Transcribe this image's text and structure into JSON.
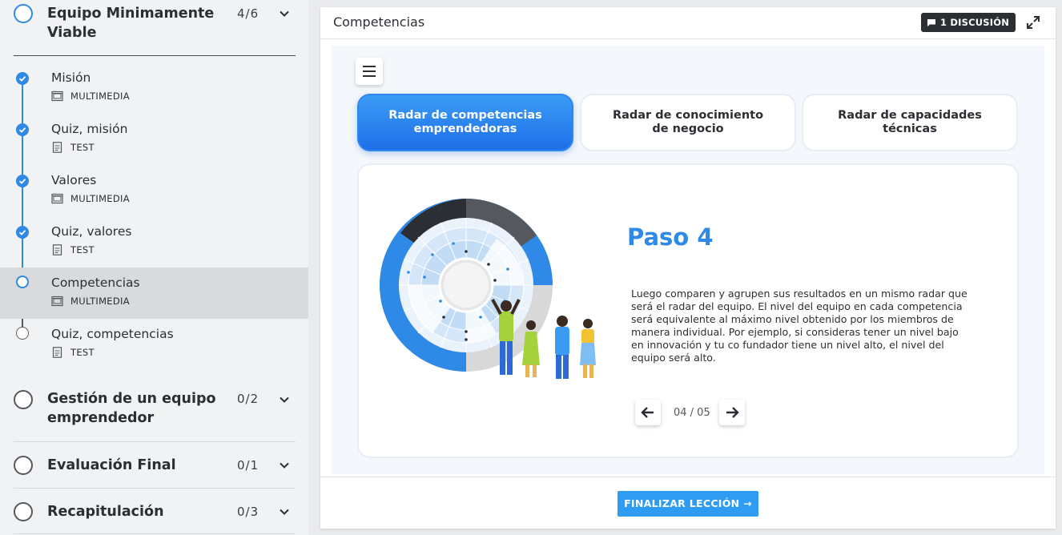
{
  "sidebar": {
    "sections": [
      {
        "title_line1": "Equipo Minimamente",
        "title_line2": "Viable",
        "count": "4/6"
      },
      {
        "title_line1": "Gestión de un equipo",
        "title_line2": "emprendedor",
        "count": "0/2"
      },
      {
        "title_line1": "Evaluación Final",
        "count": "0/1"
      },
      {
        "title_line1": "Recapitulación",
        "count": "0/3"
      }
    ],
    "lessons": [
      {
        "title": "Misión",
        "type": "MULTIMEDIA",
        "status": "done"
      },
      {
        "title": "Quiz, misión",
        "type": "TEST",
        "status": "done"
      },
      {
        "title": "Valores",
        "type": "MULTIMEDIA",
        "status": "done"
      },
      {
        "title": "Quiz, valores",
        "type": "TEST",
        "status": "done"
      },
      {
        "title": "Competencias",
        "type": "MULTIMEDIA",
        "status": "current"
      },
      {
        "title": "Quiz, competencias",
        "type": "TEST",
        "status": "pending"
      }
    ]
  },
  "main": {
    "title": "Competencias",
    "discussion_label": "1 DISCUSIÓN",
    "tabs": [
      {
        "label": "Radar de competencias emprendedoras",
        "active": true
      },
      {
        "label": "Radar de conocimiento de negocio",
        "active": false
      },
      {
        "label": "Radar de capacidades técnicas",
        "active": false
      }
    ],
    "step_title": "Paso 4",
    "step_text": "Luego comparen y agrupen sus resultados en un mismo radar que será el radar del equipo. El nivel del equipo en cada competencia será equivalente al máximo nivel obtenido por los miembros de manera individual. Por ejemplo, si consideras tener un nivel bajo en innovación y tu co fundador tiene un nivel alto, el nivel del equipo será alto.",
    "pager": "04 / 05",
    "finish_label": "FINALIZAR LECCIÓN"
  },
  "colors": {
    "accent": "#2e8ae6",
    "tab_active": "#1f6fe8",
    "finish_button": "#2e9cf2",
    "dark_badge": "#2b2f33"
  },
  "icons": [
    "chevron-down-icon",
    "check-icon",
    "multimedia-icon",
    "test-icon",
    "chat-icon",
    "expand-icon",
    "menu-icon",
    "arrow-left-icon",
    "arrow-right-icon"
  ]
}
